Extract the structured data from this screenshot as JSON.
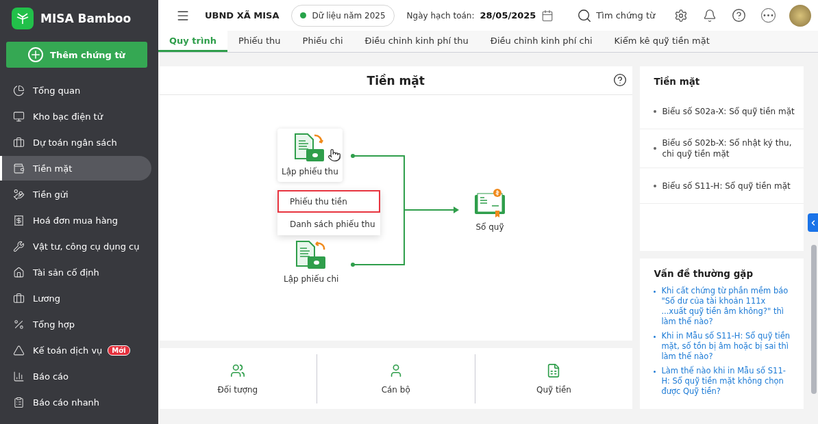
{
  "app": {
    "name": "MISA Bamboo",
    "add_button": "Thêm chứng từ"
  },
  "sidebar": {
    "items": [
      {
        "label": "Tổng quan",
        "selected": false
      },
      {
        "label": "Kho bạc điện tử",
        "selected": false
      },
      {
        "label": "Dự toán ngân sách",
        "selected": false
      },
      {
        "label": "Tiền mặt",
        "selected": true
      },
      {
        "label": "Tiền gửi",
        "selected": false
      },
      {
        "label": "Hoá đơn mua hàng",
        "selected": false
      },
      {
        "label": "Vật tư, công cụ dụng cụ",
        "selected": false
      },
      {
        "label": "Tài sản cố định",
        "selected": false
      },
      {
        "label": "Lương",
        "selected": false
      },
      {
        "label": "Tổng hợp",
        "selected": false
      },
      {
        "label": "Kế toán dịch vụ",
        "selected": false,
        "badge": "Mới"
      },
      {
        "label": "Báo cáo",
        "selected": false
      },
      {
        "label": "Báo cáo nhanh",
        "selected": false
      }
    ]
  },
  "topbar": {
    "unit": "UBND XÃ MISA",
    "data_year": "Dữ liệu năm 2025",
    "date_label": "Ngày hạch toán:",
    "date": "28/05/2025",
    "search": "Tìm chứng từ"
  },
  "tabs": [
    {
      "label": "Quy trình",
      "selected": true
    },
    {
      "label": "Phiếu thu",
      "selected": false
    },
    {
      "label": "Phiếu chi",
      "selected": false
    },
    {
      "label": "Điều chỉnh kinh phí thu",
      "selected": false
    },
    {
      "label": "Điều chỉnh kinh phí chi",
      "selected": false
    },
    {
      "label": "Kiểm kê quỹ tiền mặt",
      "selected": false
    }
  ],
  "diagram": {
    "title": "Tiền mặt",
    "receipt": "Lập phiếu thu",
    "menu": [
      {
        "label": "Phiếu thu tiền",
        "highlighted": true
      },
      {
        "label": "Danh sách phiếu thu",
        "highlighted": false
      }
    ],
    "payment": "Lập phiếu chi",
    "ledger": "Sổ quỹ"
  },
  "shortcuts": [
    "Đối tượng",
    "Cán bộ",
    "Quỹ tiền"
  ],
  "reports": {
    "title": "Tiền mặt",
    "items": [
      "Biểu số S02a-X: Sổ quỹ tiền mặt",
      "Biểu số S02b-X: Sổ nhật ký thu, chi quỹ tiền mặt",
      "Biểu số S11-H: Sổ quỹ tiền mặt"
    ]
  },
  "faq": {
    "title": "Vấn đề thường gặp",
    "items": [
      "Khi cất chứng từ phần mềm báo \"Số dư của tài khoản 111x ...xuất quỹ tiền âm không?\" thì làm thế nào?",
      "Khi in Mẫu số S11-H: Sổ quỹ tiền mặt, số tồn bị âm hoặc bị sai thì làm thế nào?",
      "Làm thế nào khi in Mẫu số S11-H: Sổ quỹ tiền mặt không chọn được Quỹ tiền?"
    ]
  }
}
